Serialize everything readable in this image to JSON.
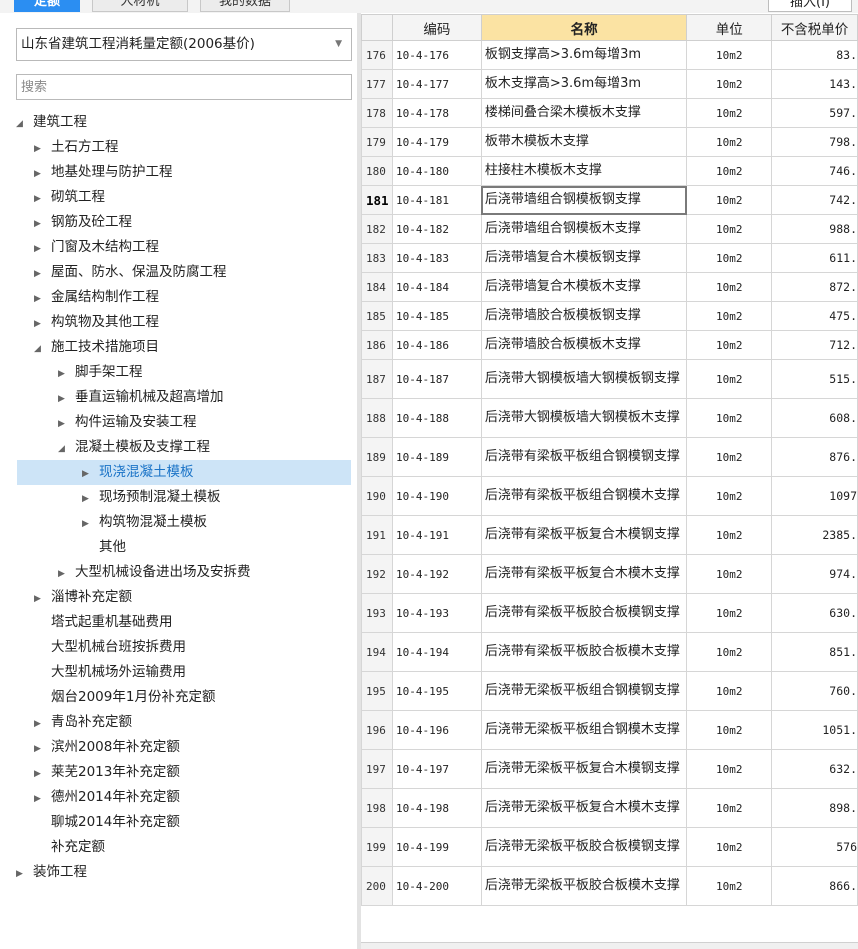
{
  "tabs": [
    {
      "label": "定额",
      "active": true
    },
    {
      "label": "人材机",
      "active": false
    },
    {
      "label": "我的数据",
      "active": false
    }
  ],
  "toolbar": {
    "insert_label": "插入(I)"
  },
  "left_panel": {
    "quota_select": "山东省建筑工程消耗量定额(2006基价)",
    "search_placeholder": "搜索",
    "tree": [
      {
        "label": "建筑工程",
        "level": 0,
        "arrow": "expanded"
      },
      {
        "label": "土石方工程",
        "level": 1,
        "arrow": "collapsed"
      },
      {
        "label": "地基处理与防护工程",
        "level": 1,
        "arrow": "collapsed"
      },
      {
        "label": "砌筑工程",
        "level": 1,
        "arrow": "collapsed"
      },
      {
        "label": "钢筋及砼工程",
        "level": 1,
        "arrow": "collapsed"
      },
      {
        "label": "门窗及木结构工程",
        "level": 1,
        "arrow": "collapsed"
      },
      {
        "label": "屋面、防水、保温及防腐工程",
        "level": 1,
        "arrow": "collapsed"
      },
      {
        "label": "金属结构制作工程",
        "level": 1,
        "arrow": "collapsed"
      },
      {
        "label": "构筑物及其他工程",
        "level": 1,
        "arrow": "collapsed"
      },
      {
        "label": "施工技术措施项目",
        "level": 1,
        "arrow": "expanded"
      },
      {
        "label": "脚手架工程",
        "level": 2,
        "arrow": "collapsed"
      },
      {
        "label": "垂直运输机械及超高增加",
        "level": 2,
        "arrow": "collapsed"
      },
      {
        "label": "构件运输及安装工程",
        "level": 2,
        "arrow": "collapsed"
      },
      {
        "label": "混凝土模板及支撑工程",
        "level": 2,
        "arrow": "expanded"
      },
      {
        "label": "现浇混凝土模板",
        "level": 3,
        "arrow": "collapsed",
        "selected": true
      },
      {
        "label": "现场预制混凝土模板",
        "level": 3,
        "arrow": "collapsed"
      },
      {
        "label": "构筑物混凝土模板",
        "level": 3,
        "arrow": "collapsed"
      },
      {
        "label": "其他",
        "level": 3,
        "arrow": "none"
      },
      {
        "label": "大型机械设备进出场及安拆费",
        "level": 2,
        "arrow": "collapsed"
      },
      {
        "label": "淄博补充定额",
        "level": 1,
        "arrow": "collapsed"
      },
      {
        "label": "塔式起重机基础费用",
        "level": 1,
        "arrow": "none"
      },
      {
        "label": "大型机械台班按拆费用",
        "level": 1,
        "arrow": "none"
      },
      {
        "label": "大型机械场外运输费用",
        "level": 1,
        "arrow": "none"
      },
      {
        "label": "烟台2009年1月份补充定额",
        "level": 1,
        "arrow": "none"
      },
      {
        "label": "青岛补充定额",
        "level": 1,
        "arrow": "collapsed"
      },
      {
        "label": "滨州2008年补充定额",
        "level": 1,
        "arrow": "collapsed"
      },
      {
        "label": "莱芜2013年补充定额",
        "level": 1,
        "arrow": "collapsed"
      },
      {
        "label": "德州2014年补充定额",
        "level": 1,
        "arrow": "collapsed"
      },
      {
        "label": "聊城2014年补充定额",
        "level": 1,
        "arrow": "none"
      },
      {
        "label": "补充定额",
        "level": 1,
        "arrow": "none"
      },
      {
        "label": "装饰工程",
        "level": 0,
        "arrow": "collapsed"
      }
    ]
  },
  "grid": {
    "headers": [
      "",
      "编码",
      "名称",
      "单位",
      "不含税单价"
    ],
    "current_row": "181",
    "rows": [
      {
        "n": "176",
        "code": "10-4-176",
        "name": "板钢支撑高>3.6m每增3m",
        "unit": "10m2",
        "price": "83."
      },
      {
        "n": "177",
        "code": "10-4-177",
        "name": "板木支撑高>3.6m每增3m",
        "unit": "10m2",
        "price": "143."
      },
      {
        "n": "178",
        "code": "10-4-178",
        "name": "楼梯间叠合梁木模板木支撑",
        "unit": "10m2",
        "price": "597."
      },
      {
        "n": "179",
        "code": "10-4-179",
        "name": "板带木模板木支撑",
        "unit": "10m2",
        "price": "798."
      },
      {
        "n": "180",
        "code": "10-4-180",
        "name": "柱接柱木模板木支撑",
        "unit": "10m2",
        "price": "746."
      },
      {
        "n": "181",
        "code": "10-4-181",
        "name": "后浇带墙组合钢模板钢支撑",
        "unit": "10m2",
        "price": "742."
      },
      {
        "n": "182",
        "code": "10-4-182",
        "name": "后浇带墙组合钢模板木支撑",
        "unit": "10m2",
        "price": "988."
      },
      {
        "n": "183",
        "code": "10-4-183",
        "name": "后浇带墙复合木模板钢支撑",
        "unit": "10m2",
        "price": "611."
      },
      {
        "n": "184",
        "code": "10-4-184",
        "name": "后浇带墙复合木模板木支撑",
        "unit": "10m2",
        "price": "872."
      },
      {
        "n": "185",
        "code": "10-4-185",
        "name": "后浇带墙胶合板模板钢支撑",
        "unit": "10m2",
        "price": "475."
      },
      {
        "n": "186",
        "code": "10-4-186",
        "name": "后浇带墙胶合板模板木支撑",
        "unit": "10m2",
        "price": "712."
      },
      {
        "n": "187",
        "code": "10-4-187",
        "name": "后浇带大钢模板墙大钢模板钢支撑",
        "unit": "10m2",
        "price": "515."
      },
      {
        "n": "188",
        "code": "10-4-188",
        "name": "后浇带大钢模板墙大钢模板木支撑",
        "unit": "10m2",
        "price": "608."
      },
      {
        "n": "189",
        "code": "10-4-189",
        "name": "后浇带有梁板平板组合钢模钢支撑",
        "unit": "10m2",
        "price": "876."
      },
      {
        "n": "190",
        "code": "10-4-190",
        "name": "后浇带有梁板平板组合钢模木支撑",
        "unit": "10m2",
        "price": "1097"
      },
      {
        "n": "191",
        "code": "10-4-191",
        "name": "后浇带有梁板平板复合木模钢支撑",
        "unit": "10m2",
        "price": "2385."
      },
      {
        "n": "192",
        "code": "10-4-192",
        "name": "后浇带有梁板平板复合木模木支撑",
        "unit": "10m2",
        "price": "974."
      },
      {
        "n": "193",
        "code": "10-4-193",
        "name": "后浇带有梁板平板胶合板模钢支撑",
        "unit": "10m2",
        "price": "630."
      },
      {
        "n": "194",
        "code": "10-4-194",
        "name": "后浇带有梁板平板胶合板模木支撑",
        "unit": "10m2",
        "price": "851."
      },
      {
        "n": "195",
        "code": "10-4-195",
        "name": "后浇带无梁板平板组合钢模钢支撑",
        "unit": "10m2",
        "price": "760."
      },
      {
        "n": "196",
        "code": "10-4-196",
        "name": "后浇带无梁板平板组合钢模木支撑",
        "unit": "10m2",
        "price": "1051."
      },
      {
        "n": "197",
        "code": "10-4-197",
        "name": "后浇带无梁板平板复合木模钢支撑",
        "unit": "10m2",
        "price": "632."
      },
      {
        "n": "198",
        "code": "10-4-198",
        "name": "后浇带无梁板平板复合木模木支撑",
        "unit": "10m2",
        "price": "898."
      },
      {
        "n": "199",
        "code": "10-4-199",
        "name": "后浇带无梁板平板胶合板模钢支撑",
        "unit": "10m2",
        "price": "576"
      },
      {
        "n": "200",
        "code": "10-4-200",
        "name": "后浇带无梁板平板胶合板模木支撑",
        "unit": "10m2",
        "price": "866."
      }
    ]
  }
}
